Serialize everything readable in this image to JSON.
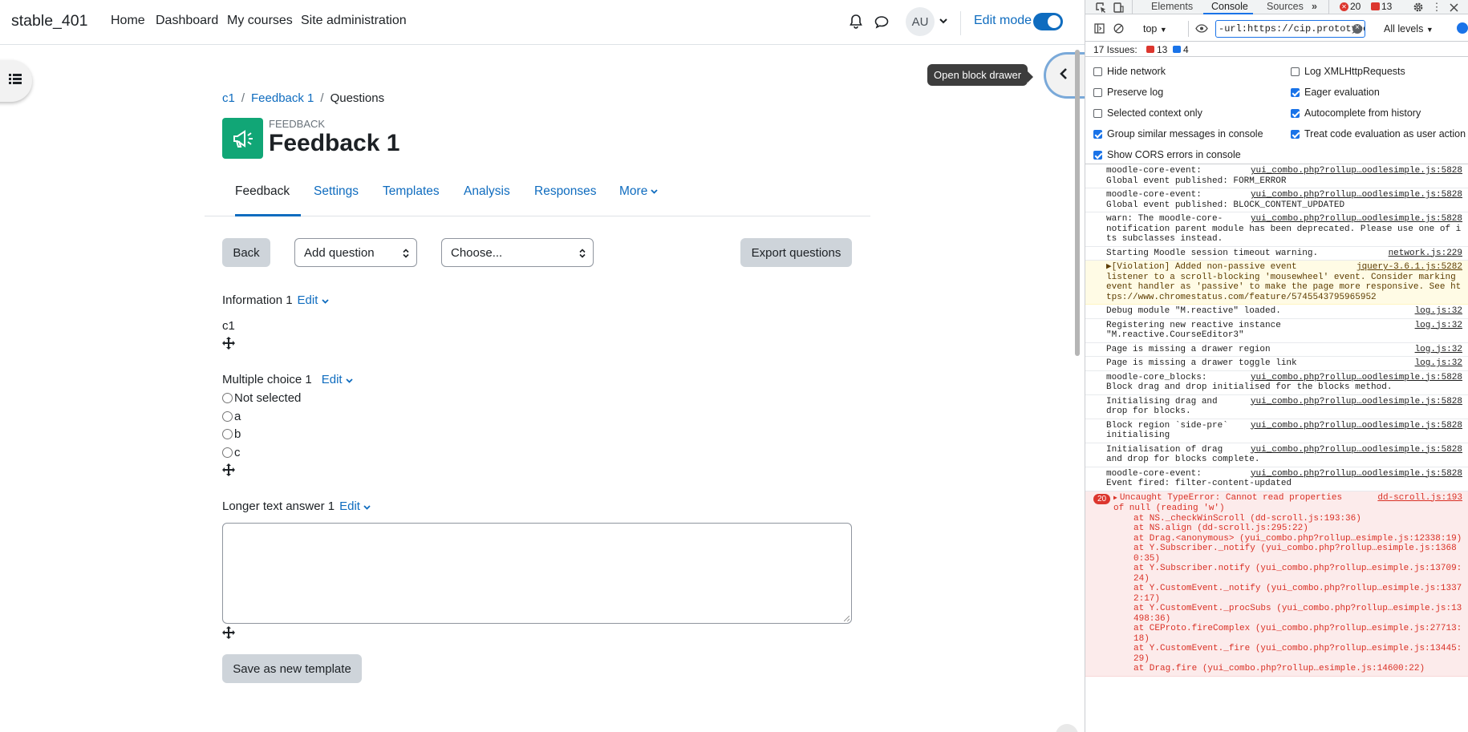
{
  "moodle": {
    "site_name": "stable_401",
    "nav": [
      "Home",
      "Dashboard",
      "My courses",
      "Site administration"
    ],
    "user_initials": "AU",
    "edit_mode_label": "Edit mode",
    "edit_mode_on": true,
    "tooltip": "Open block drawer",
    "breadcrumb": [
      "c1",
      "Feedback 1",
      "Questions"
    ],
    "activity_kicker": "FEEDBACK",
    "page_title": "Feedback 1",
    "tabs": [
      "Feedback",
      "Settings",
      "Templates",
      "Analysis",
      "Responses",
      "More"
    ],
    "active_tab": "Feedback",
    "toolbar": {
      "back": "Back",
      "add_question": "Add question",
      "choose": "Choose...",
      "export": "Export questions"
    },
    "items": {
      "info": {
        "label": "Information 1",
        "edit": "Edit",
        "value": "c1"
      },
      "multichoice": {
        "label": "Multiple choice 1",
        "edit": "Edit",
        "options": [
          "Not selected",
          "a",
          "b",
          "c"
        ]
      },
      "longtext": {
        "label": "Longer text answer 1",
        "edit": "Edit"
      }
    },
    "save_template": "Save as new template",
    "accent_color": "#0f6cbf",
    "activity_icon_color": "#11a676"
  },
  "devtools": {
    "tabs": [
      "Elements",
      "Console",
      "Sources"
    ],
    "active_tab": "Console",
    "error_count": "20",
    "warning_count": "13",
    "context": "top",
    "filter_value": "-url:https://cip.prototype.moodle",
    "levels": "All levels",
    "issues_label": "17 Issues:",
    "issues_errors": "13",
    "issues_info": "4",
    "settings": [
      {
        "label": "Hide network",
        "checked": false
      },
      {
        "label": "Log XMLHttpRequests",
        "checked": false
      },
      {
        "label": "Preserve log",
        "checked": false
      },
      {
        "label": "Eager evaluation",
        "checked": true
      },
      {
        "label": "Selected context only",
        "checked": false
      },
      {
        "label": "Autocomplete from history",
        "checked": true
      },
      {
        "label": "Group similar messages in console",
        "checked": true
      },
      {
        "label": "Treat code evaluation as user action",
        "checked": true
      },
      {
        "label": "Show CORS errors in console",
        "checked": true
      }
    ],
    "messages": [
      {
        "type": "log",
        "text": "moodle-core-event:\nGlobal event published: FORM_ERROR",
        "src": "yui_combo.php?rollup…oodlesimple.js:5828"
      },
      {
        "type": "log",
        "text": "moodle-core-event:\nGlobal event published: BLOCK_CONTENT_UPDATED",
        "src": "yui_combo.php?rollup…oodlesimple.js:5828"
      },
      {
        "type": "log",
        "text": "warn: The moodle-core-\nnotification parent module has been deprecated. Please use one of its subclasses instead.",
        "src": "yui_combo.php?rollup…oodlesimple.js:5828"
      },
      {
        "type": "log",
        "text": "Starting Moodle session timeout warning.",
        "src": "network.js:229"
      },
      {
        "type": "warn",
        "text": "▶[Violation] Added non-passive event\nlistener to a scroll-blocking 'mousewheel' event. Consider marking event handler as 'passive' to make the page more responsive. See https://www.chromestatus.com/feature/5745543795965952",
        "src": "jquery-3.6.1.js:5282"
      },
      {
        "type": "log",
        "text": "Debug module \"M.reactive\" loaded.",
        "src": "log.js:32"
      },
      {
        "type": "log",
        "text": "Registering new reactive instance\n\"M.reactive.CourseEditor3\"",
        "src": "log.js:32"
      },
      {
        "type": "log",
        "text": "Page is missing a drawer region",
        "src": "log.js:32"
      },
      {
        "type": "log",
        "text": "Page is missing a drawer toggle link",
        "src": "log.js:32"
      },
      {
        "type": "log",
        "text": "moodle-core_blocks:\nBlock drag and drop initialised for the blocks method.",
        "src": "yui_combo.php?rollup…oodlesimple.js:5828"
      },
      {
        "type": "log",
        "text": "Initialising drag and\ndrop for blocks.",
        "src": "yui_combo.php?rollup…oodlesimple.js:5828"
      },
      {
        "type": "log",
        "text": "Block region `side-pre`\ninitialising",
        "src": "yui_combo.php?rollup…oodlesimple.js:5828"
      },
      {
        "type": "log",
        "text": "Initialisation of drag\nand drop for blocks complete.",
        "src": "yui_combo.php?rollup…oodlesimple.js:5828"
      },
      {
        "type": "log",
        "text": "moodle-core-event:\nEvent fired: filter-content-updated",
        "src": "yui_combo.php?rollup…oodlesimple.js:5828"
      }
    ],
    "error": {
      "count": "20",
      "text": "Uncaught TypeError: Cannot read properties\nof null (reading 'w')",
      "src": "dd-scroll.js:193",
      "stack": [
        "at NS._checkWinScroll (dd-scroll.js:193:36)",
        "at NS.align (dd-scroll.js:295:22)",
        "at Drag.<anonymous> (yui_combo.php?rollup…esimple.js:12338:19)",
        "at Y.Subscriber._notify (yui_combo.php?rollup…esimple.js:13680:35)",
        "at Y.Subscriber.notify (yui_combo.php?rollup…esimple.js:13709:24)",
        "at Y.CustomEvent._notify (yui_combo.php?rollup…esimple.js:13372:17)",
        "at Y.CustomEvent._procSubs (yui_combo.php?rollup…esimple.js:13498:36)",
        "at CEProto.fireComplex (yui_combo.php?rollup…esimple.js:27713:18)",
        "at Y.CustomEvent._fire (yui_combo.php?rollup…esimple.js:13445:29)",
        "at Drag.fire (yui_combo.php?rollup…esimple.js:14600:22)"
      ]
    }
  }
}
